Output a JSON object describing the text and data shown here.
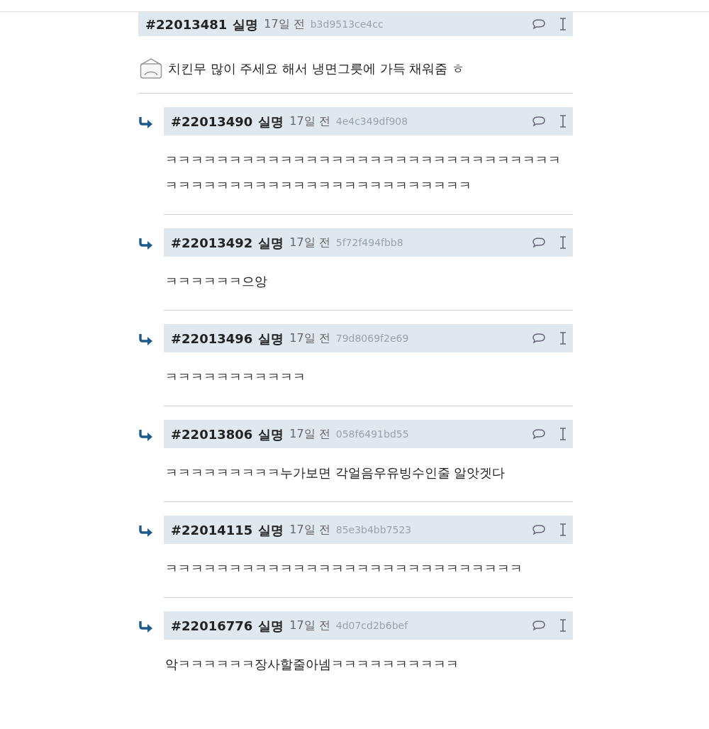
{
  "comments": [
    {
      "kind": "post",
      "number": "#22013481",
      "author": "실명",
      "time": "17일 전",
      "hash": "b3d9513ce4cc",
      "text": "치킨무 많이 주세요 해서 냉면그릇에 가득 채워줌 ㅎ"
    },
    {
      "kind": "reply",
      "number": "#22013490",
      "author": "실명",
      "time": "17일 전",
      "hash": "4e4c349df908",
      "text": "ㅋㅋㅋㅋㅋㅋㅋㅋㅋㅋㅋㅋㅋㅋㅋㅋㅋㅋㅋㅋㅋㅋㅋㅋㅋㅋㅋㅋㅋㅋㅋㅋㅋㅋㅋㅋㅋㅋㅋㅋㅋㅋㅋㅋㅋㅋㅋㅋㅋㅋㅋㅋㅋㅋㅋ"
    },
    {
      "kind": "reply",
      "number": "#22013492",
      "author": "실명",
      "time": "17일 전",
      "hash": "5f72f494fbb8",
      "text": "ㅋㅋㅋㅋㅋㅋ으앙"
    },
    {
      "kind": "reply",
      "number": "#22013496",
      "author": "실명",
      "time": "17일 전",
      "hash": "79d8069f2e69",
      "text": "ㅋㅋㅋㅋㅋㅋㅋㅋㅋㅋㅋ"
    },
    {
      "kind": "reply",
      "number": "#22013806",
      "author": "실명",
      "time": "17일 전",
      "hash": "058f6491bd55",
      "text": "ㅋㅋㅋㅋㅋㅋㅋㅋㅋ누가보면 각얼음우유빙수인줄 알앗겟다"
    },
    {
      "kind": "reply",
      "number": "#22014115",
      "author": "실명",
      "time": "17일 전",
      "hash": "85e3b4bb7523",
      "text": "ㅋㅋㅋㅋㅋㅋㅋㅋㅋㅋㅋㅋㅋㅋㅋㅋㅋㅋㅋㅋㅋㅋㅋㅋㅋㅋㅋㅋ"
    },
    {
      "kind": "reply",
      "number": "#22016776",
      "author": "실명",
      "time": "17일 전",
      "hash": "4d07cd2b6bef",
      "text": "악ㅋㅋㅋㅋㅋㅋ장사할줄아넴ㅋㅋㅋㅋㅋㅋㅋㅋㅋㅋ"
    }
  ]
}
